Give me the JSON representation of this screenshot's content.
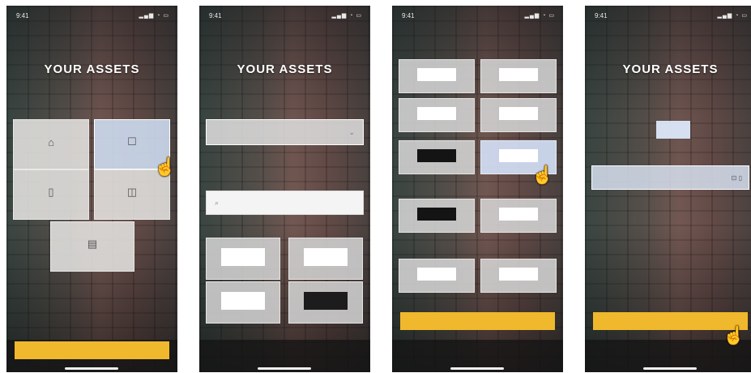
{
  "status": {
    "time": "9:41",
    "icons": "▂▄▆ ◔ ▭"
  },
  "onboarding": {
    "top_text": "",
    "title": "YOUR ASSETS",
    "description": ""
  },
  "panel1": {
    "tiles": [
      {
        "label": "",
        "icon": "⌂"
      },
      {
        "label": "",
        "icon": "☐"
      },
      {
        "label": "",
        "icon": "▯"
      },
      {
        "label": "",
        "icon": "◫"
      },
      {
        "label": "",
        "icon": "▤"
      }
    ],
    "cta": ""
  },
  "panel2": {
    "dropdown_value": "",
    "mid_text": "",
    "search_placeholder": "",
    "brands": [
      {
        "logo": "",
        "label": ""
      },
      {
        "logo": "",
        "label": ""
      },
      {
        "logo": "",
        "label": ""
      },
      {
        "logo": "",
        "label": ""
      }
    ],
    "link_text": ""
  },
  "panel3": {
    "brands": [
      {
        "logo": "",
        "label": ""
      },
      {
        "logo": "",
        "label": ""
      },
      {
        "logo": "",
        "label": ""
      },
      {
        "logo": "",
        "label": ""
      },
      {
        "logo": "",
        "label": ""
      },
      {
        "logo": "",
        "label": ""
      },
      {
        "logo": "",
        "label": ""
      },
      {
        "logo": "",
        "label": ""
      },
      {
        "logo": "",
        "label": ""
      },
      {
        "logo": "",
        "label": ""
      }
    ],
    "cta": ""
  },
  "panel4": {
    "selected_chip": "",
    "section_label": "",
    "input_value": "",
    "cta": ""
  },
  "colors": {
    "accent": "#f0b82c",
    "selected": "#cddcf0"
  }
}
